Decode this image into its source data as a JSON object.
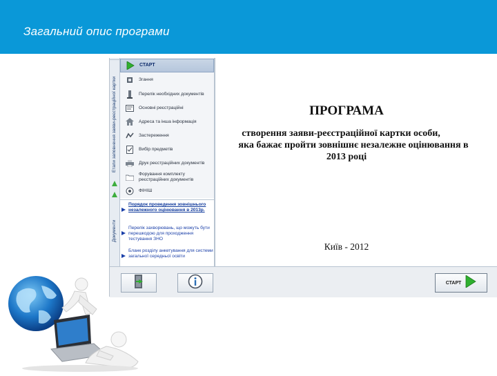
{
  "slide": {
    "title": "Загальний опис програми"
  },
  "app": {
    "vertical_tabs": [
      "Етапи заповнення заяви-реєстраційної картки",
      "Документи"
    ],
    "menu": [
      {
        "label": "СТАРТ",
        "icon": "play-icon",
        "active": true
      },
      {
        "label": "Згання",
        "icon": "info-icon",
        "active": false
      },
      {
        "label": "Перелік необхідних документів",
        "icon": "documents-icon",
        "active": false
      },
      {
        "label": "Основні реєстраційні",
        "icon": "form-icon",
        "active": false
      },
      {
        "label": "Адреса та інша інформація",
        "icon": "address-icon",
        "active": false
      },
      {
        "label": "Застереження",
        "icon": "warning-icon",
        "active": false
      },
      {
        "label": "Вибір предметів",
        "icon": "checklist-icon",
        "active": false
      },
      {
        "label": "Друк реєстраційних документів",
        "icon": "print-icon",
        "active": false
      },
      {
        "label": "Форування комплекту реєстраційних документів",
        "icon": "folder-icon",
        "active": false
      },
      {
        "label": "ФІНІШ",
        "icon": "finish-icon",
        "active": false
      }
    ],
    "documents": [
      "Порядок проведення зовнішнього незалежного оцінювання в 2013р.",
      "Перелік захворювань, що можуть бути перешкодою для проходження тестування ЗНО",
      "Бланк розділу анкетування для системи загальної середньої освіти"
    ],
    "content": {
      "title": "ПРОГРАМА",
      "subtitle_lines": [
        "створення заяви-реєстраційної картки особи,",
        "яка бажає пройти зовнішнє незалежне оцінювання в",
        "2013 році"
      ],
      "footer": "Київ - 2012"
    },
    "toolbar": {
      "exit_icon": "exit-door-icon",
      "info_icon": "info-circle-icon",
      "start_label": "СТАРТ"
    }
  },
  "colors": {
    "header": "#0a98d8",
    "accent_green": "#2fb02f",
    "link_blue": "#1a3fa8"
  }
}
